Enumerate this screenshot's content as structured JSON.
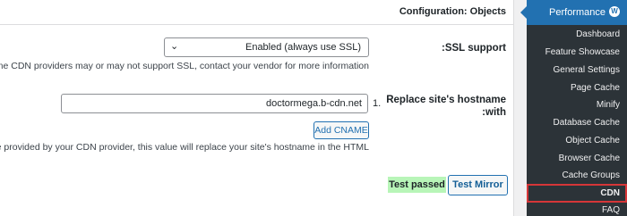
{
  "panel": {
    "title": "Configuration: Objects"
  },
  "ssl": {
    "label": "SSL support:",
    "select_value": "Enabled (always use SSL)",
    "description": "Some CDN providers may or may not support SSL, contact your vendor for more information."
  },
  "hostname": {
    "label": "Replace site's hostname with:",
    "row_number": "1.",
    "value": "doctormega.b-cdn.net",
    "add_button": "Add CNAME",
    "description": "…ostname provided by your CDN provider, this value will replace your site's hostname in the HTML"
  },
  "test": {
    "status": "Test passed",
    "status_color": "#b8f5b8",
    "button": "Test Mirror"
  },
  "sidebar": {
    "title": "Performance",
    "icon": "w3tc-icon",
    "items": [
      {
        "label": "Dashboard"
      },
      {
        "label": "Feature Showcase"
      },
      {
        "label": "General Settings"
      },
      {
        "label": "Page Cache"
      },
      {
        "label": "Minify"
      },
      {
        "label": "Database Cache"
      },
      {
        "label": "Object Cache"
      },
      {
        "label": "Browser Cache"
      },
      {
        "label": "Cache Groups"
      },
      {
        "label": "CDN",
        "active": true
      },
      {
        "label": "FAQ"
      }
    ]
  },
  "colors": {
    "accent": "#2271b1",
    "sidebar_bg": "#2c3338",
    "highlight_border": "#d63638"
  }
}
